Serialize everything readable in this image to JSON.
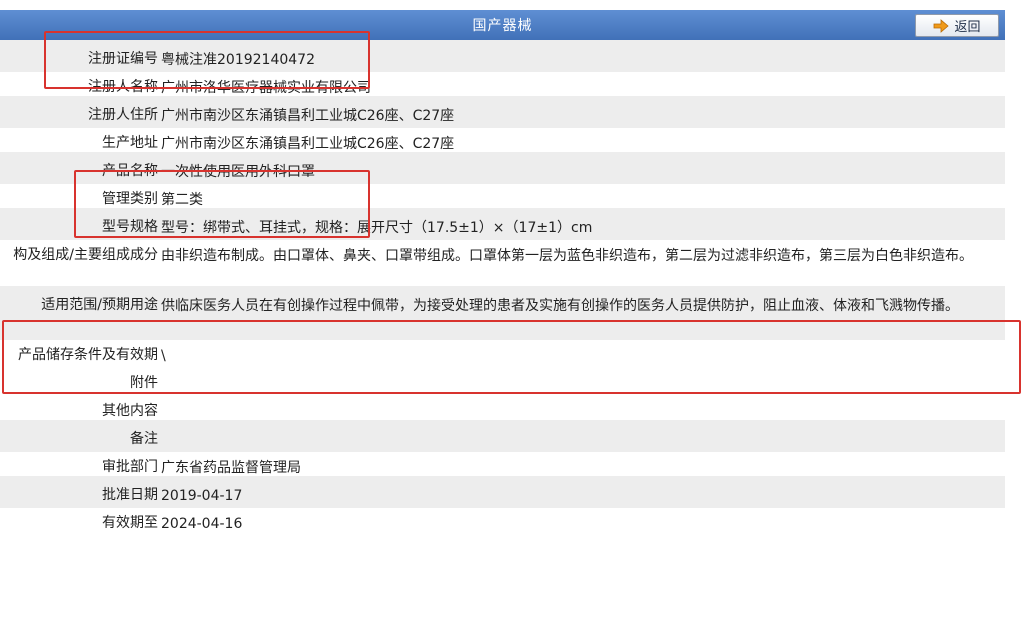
{
  "header": {
    "title": "国产器械",
    "back_label": "返回"
  },
  "rows": [
    {
      "label": "注册证编号",
      "value": "粤械注准20192140472"
    },
    {
      "label": "注册人名称",
      "value": "广州市洛华医疗器械实业有限公司"
    },
    {
      "label": "注册人住所",
      "value": "广州市南沙区东涌镇昌利工业城C26座、C27座"
    },
    {
      "label": "生产地址",
      "value": "广州市南沙区东涌镇昌利工业城C26座、C27座"
    },
    {
      "label": "产品名称",
      "value": "一次性使用医用外科口罩"
    },
    {
      "label": "管理类别",
      "value": "第二类"
    },
    {
      "label": "型号规格",
      "value": "型号：绑带式、耳挂式，规格：展开尺寸（17.5±1）×（17±1）cm"
    },
    {
      "label": "构及组成/主要组成成分",
      "value": "由非织造布制成。由口罩体、鼻夹、口罩带组成。口罩体第一层为蓝色非织造布，第二层为过滤非织造布，第三层为白色非织造布。"
    },
    {
      "label": "适用范围/预期用途",
      "value": "供临床医务人员在有创操作过程中佩带，为接受处理的患者及实施有创操作的医务人员提供防护，阻止血液、体液和飞溅物传播。"
    },
    {
      "label": "产品储存条件及有效期",
      "value": "\\"
    },
    {
      "label": "附件",
      "value": ""
    },
    {
      "label": "其他内容",
      "value": ""
    },
    {
      "label": "备注",
      "value": ""
    },
    {
      "label": "审批部门",
      "value": "广东省药品监督管理局"
    },
    {
      "label": "批准日期",
      "value": "2019-04-17"
    },
    {
      "label": "有效期至",
      "value": "2024-04-16"
    }
  ],
  "colors": {
    "header_bg": "#4a7cc4",
    "row_shade": "#ededed",
    "highlight": "#d8332e"
  }
}
